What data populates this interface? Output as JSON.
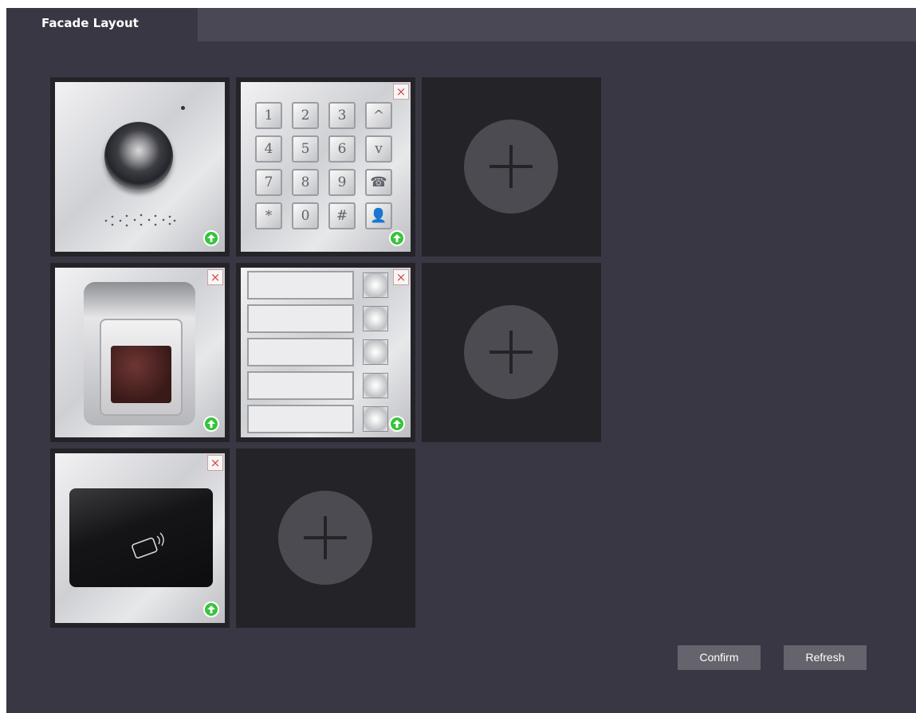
{
  "tabs": {
    "facade_layout": "Facade Layout"
  },
  "modules": {
    "camera": {
      "remove_icon": "close-icon",
      "upgrade_icon": "arrow-up-icon"
    },
    "keypad": {
      "keys": [
        "1",
        "2",
        "3",
        "^",
        "4",
        "5",
        "6",
        "v",
        "7",
        "8",
        "9",
        "☎",
        "*",
        "0",
        "#",
        "👤"
      ],
      "remove_label": "×"
    },
    "fingerprint": {
      "remove_label": "×"
    },
    "buttons": {
      "rows": 5,
      "remove_label": "×"
    },
    "card_reader": {
      "remove_label": "×"
    }
  },
  "add_slots": [
    "add",
    "add",
    "add"
  ],
  "actions": {
    "confirm_label": "Confirm",
    "refresh_label": "Refresh"
  },
  "colors": {
    "background": "#383743",
    "tab_bar": "#4a4855",
    "slot": "#242328",
    "upgrade_green": "#35c43a",
    "remove_red": "#d94444",
    "button_gray": "#65646d"
  }
}
